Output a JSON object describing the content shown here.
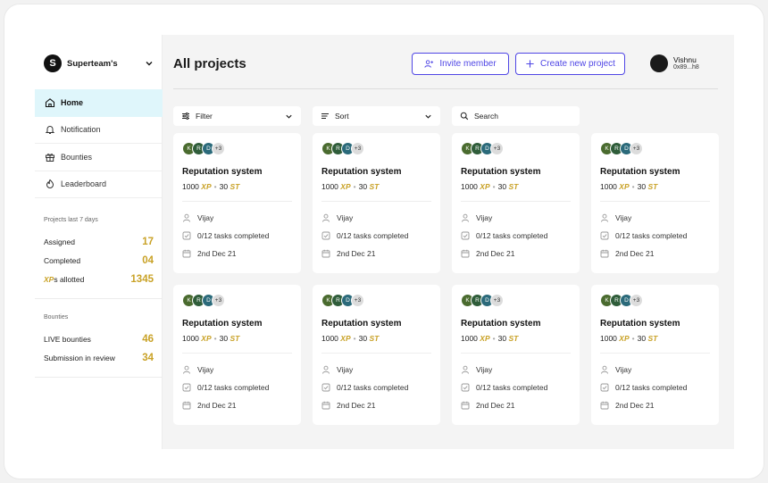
{
  "workspace": {
    "name": "Superteam's",
    "logo": "S"
  },
  "nav": [
    {
      "label": "Home",
      "icon": "home-icon",
      "active": true
    },
    {
      "label": "Notification",
      "icon": "bell-icon",
      "active": false
    },
    {
      "label": "Bounties",
      "icon": "gift-icon",
      "active": false
    },
    {
      "label": "Leaderboard",
      "icon": "trophy-icon",
      "active": false
    }
  ],
  "projects_stats": {
    "title": "Projects last 7 days",
    "assigned_label": "Assigned",
    "assigned_value": "17",
    "completed_label": "Completed",
    "completed_value": "04",
    "xp_prefix": "XP",
    "xp_suffix": "s allotted",
    "xp_value": "1345"
  },
  "bounties_stats": {
    "title": "Bounties",
    "live_label": "LIVE bounties",
    "live_value": "46",
    "review_label": "Submission in review",
    "review_value": "34"
  },
  "header": {
    "title": "All projects",
    "invite_label": "Invite member",
    "create_label": "Create new project",
    "user_name": "Vishnu",
    "user_addr": "0x89...h8"
  },
  "controls": {
    "filter": "Filter",
    "sort": "Sort",
    "search": "Search"
  },
  "colors": {
    "accent": "#4f46e5",
    "gold": "#c9a227",
    "active_nav": "#dff6fb",
    "avatar_k": "#4a6b2f",
    "avatar_r": "#2f5d3a",
    "avatar_d": "#2b6a7a"
  },
  "cards": [
    {
      "avatars": [
        "K",
        "R",
        "D"
      ],
      "more": "+3",
      "title": "Reputation system",
      "xp": "1000",
      "xp_unit": "XP",
      "st": "30",
      "st_unit": "ST",
      "assignee": "Vijay",
      "tasks": "0/12 tasks completed",
      "date": "2nd Dec 21"
    },
    {
      "avatars": [
        "K",
        "R",
        "D"
      ],
      "more": "+3",
      "title": "Reputation system",
      "xp": "1000",
      "xp_unit": "XP",
      "st": "30",
      "st_unit": "ST",
      "assignee": "Vijay",
      "tasks": "0/12 tasks completed",
      "date": "2nd Dec 21"
    },
    {
      "avatars": [
        "K",
        "R",
        "D"
      ],
      "more": "+3",
      "title": "Reputation system",
      "xp": "1000",
      "xp_unit": "XP",
      "st": "30",
      "st_unit": "ST",
      "assignee": "Vijay",
      "tasks": "0/12 tasks completed",
      "date": "2nd Dec 21"
    },
    {
      "avatars": [
        "K",
        "R",
        "D"
      ],
      "more": "+3",
      "title": "Reputation system",
      "xp": "1000",
      "xp_unit": "XP",
      "st": "30",
      "st_unit": "ST",
      "assignee": "Vijay",
      "tasks": "0/12 tasks completed",
      "date": "2nd Dec 21"
    },
    {
      "avatars": [
        "K",
        "R",
        "D"
      ],
      "more": "+3",
      "title": "Reputation system",
      "xp": "1000",
      "xp_unit": "XP",
      "st": "30",
      "st_unit": "ST",
      "assignee": "Vijay",
      "tasks": "0/12 tasks completed",
      "date": "2nd Dec 21"
    },
    {
      "avatars": [
        "K",
        "R",
        "D"
      ],
      "more": "+3",
      "title": "Reputation system",
      "xp": "1000",
      "xp_unit": "XP",
      "st": "30",
      "st_unit": "ST",
      "assignee": "Vijay",
      "tasks": "0/12 tasks completed",
      "date": "2nd Dec 21"
    },
    {
      "avatars": [
        "K",
        "R",
        "D"
      ],
      "more": "+3",
      "title": "Reputation system",
      "xp": "1000",
      "xp_unit": "XP",
      "st": "30",
      "st_unit": "ST",
      "assignee": "Vijay",
      "tasks": "0/12 tasks completed",
      "date": "2nd Dec 21"
    },
    {
      "avatars": [
        "K",
        "R",
        "D"
      ],
      "more": "+3",
      "title": "Reputation system",
      "xp": "1000",
      "xp_unit": "XP",
      "st": "30",
      "st_unit": "ST",
      "assignee": "Vijay",
      "tasks": "0/12 tasks completed",
      "date": "2nd Dec 21"
    }
  ]
}
